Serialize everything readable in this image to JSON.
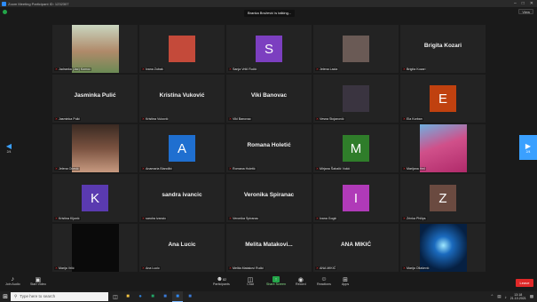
{
  "window": {
    "title": "Zoom Meeting Participant ID: 1232307"
  },
  "talking_indicator": "Branka Brožević is talking...",
  "view_label": "View",
  "nav": {
    "left_page": "2/4",
    "right_page": "2/4"
  },
  "participants": [
    {
      "label": "Jadranka (Jac) Komoc",
      "kind": "photo",
      "photo_color": "#b08a6a"
    },
    {
      "label": "Ivana Zubak",
      "kind": "photo",
      "photo_color": "#c44a3a"
    },
    {
      "label": "Sanja Vrtič Ručić",
      "kind": "letter",
      "letter": "S",
      "avatar_color": "#7c3fc0"
    },
    {
      "label": "Jelena Lacia",
      "kind": "photo",
      "photo_color": "#6a5a55"
    },
    {
      "label": "Brigita Kozari",
      "kind": "name",
      "center_name": "Brigita Kozari"
    },
    {
      "label": "Jasminka Pulić",
      "kind": "name",
      "center_name": "Jasminka Pulić"
    },
    {
      "label": "Kristina Vuković",
      "kind": "name",
      "center_name": "Kristina Vuković"
    },
    {
      "label": "Viki Banovac",
      "kind": "name",
      "center_name": "Viki Banovac"
    },
    {
      "label": "Vesna Stojanović",
      "kind": "photo",
      "photo_color": "#3a3440"
    },
    {
      "label": "Ela Korban",
      "kind": "letter",
      "letter": "E",
      "avatar_color": "#c0410f"
    },
    {
      "label": "Jelena Očević",
      "kind": "photo",
      "photo_color": "#5a3d30"
    },
    {
      "label": "Anamaria Blandžić",
      "kind": "letter",
      "letter": "A",
      "avatar_color": "#1f6fd0"
    },
    {
      "label": "Romana Holetić",
      "kind": "name",
      "center_name": "Romana Holetić"
    },
    {
      "label": "Mirjana Šabalić Vukić",
      "kind": "letter",
      "letter": "M",
      "avatar_color": "#2f7d2a"
    },
    {
      "label": "Marijana Heč",
      "kind": "photo",
      "photo_color": "#b0509a"
    },
    {
      "label": "Kristina Kljunić",
      "kind": "letter",
      "letter": "K",
      "avatar_color": "#5a3ab0"
    },
    {
      "label": "sandra ivancic",
      "kind": "name",
      "center_name": "sandra ivancic"
    },
    {
      "label": "Veronika Spiranac",
      "kind": "name",
      "center_name": "Veronika Spiranac"
    },
    {
      "label": "Ivana Gogić",
      "kind": "letter",
      "letter": "I",
      "avatar_color": "#b03ab8"
    },
    {
      "label": "Zrinka Philips",
      "kind": "letter",
      "letter": "Z",
      "avatar_color": "#6a4a40"
    },
    {
      "label": "Marija Vrlić",
      "kind": "photo",
      "photo_color": "#0a0a0a"
    },
    {
      "label": "Ana Lucic",
      "kind": "name",
      "center_name": "Ana Lucic"
    },
    {
      "label": "Melita Matakovi Ručić",
      "kind": "name",
      "center_name": "Melita Matakovi..."
    },
    {
      "label": "ANA MIKIĆ",
      "kind": "name",
      "center_name": "ANA MIKIĆ"
    },
    {
      "label": "Marija Ollašević",
      "kind": "photo",
      "photo_color": "#0a2a5a"
    }
  ],
  "toolbar": {
    "unmute": "Join Audio",
    "video": "Start Video",
    "participants": "Participants",
    "participants_count": "82",
    "chat": "Chat",
    "share": "Share Screen",
    "record": "Record",
    "reactions": "Reactions",
    "apps": "Apps",
    "leave": "Leave"
  },
  "taskbar": {
    "search_placeholder": "Type here to search",
    "time": "13:18",
    "date": "21.10.2021"
  }
}
